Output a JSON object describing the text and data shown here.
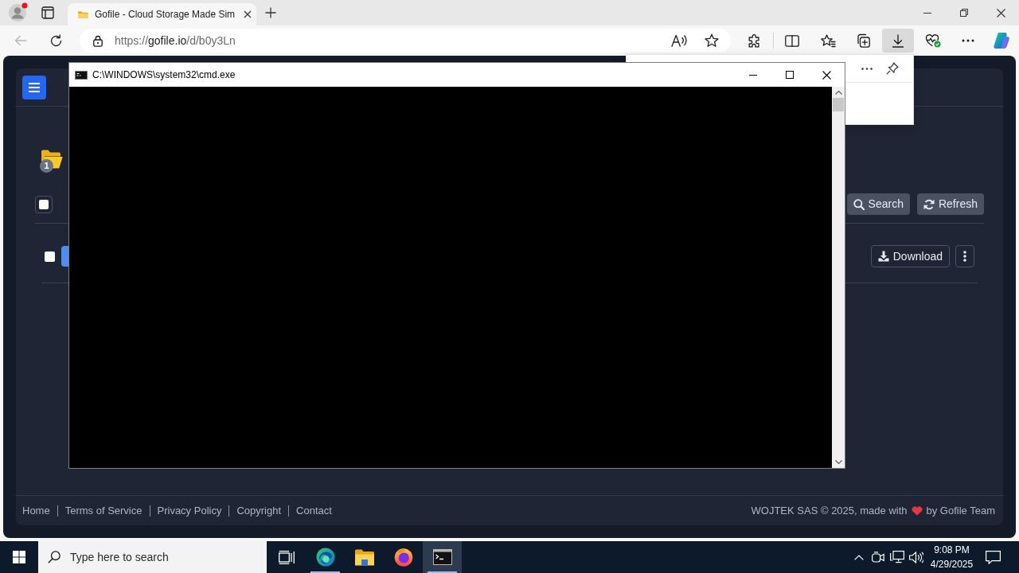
{
  "browser": {
    "tabs": [
      {
        "title": "Gofile - Cloud Storage Made Sim",
        "selected": true
      }
    ],
    "back_disabled": true,
    "address": {
      "scheme": "https://",
      "host": "gofile.io",
      "path": "/d/b0y3Ln"
    },
    "downloads_open": true
  },
  "page": {
    "folder": {
      "badge": "1"
    },
    "select_all": {
      "checked": false
    },
    "actions": [
      {
        "kind": "search",
        "label": "Search"
      },
      {
        "kind": "refresh",
        "label": "Refresh"
      }
    ],
    "files": [
      {
        "checked": false,
        "download": "Download"
      }
    ],
    "footer": {
      "links": [
        "Home",
        "Terms of Service",
        "Privacy Policy",
        "Copyright",
        "Contact"
      ],
      "credit_before": "WOJTEK SAS © 2025, made with",
      "credit_after": "by Gofile Team"
    }
  },
  "console_window": {
    "title": "C:\\WINDOWS\\system32\\cmd.exe"
  },
  "taskbar": {
    "search": {
      "placeholder": "Type here to search"
    },
    "apps": [
      {
        "kind": "edge",
        "running": true,
        "active": false
      },
      {
        "kind": "explorer",
        "running": false,
        "active": false
      },
      {
        "kind": "firefox",
        "running": false,
        "active": false
      },
      {
        "kind": "terminal",
        "running": true,
        "active": true
      }
    ],
    "clock": {
      "time": "9:08 PM",
      "date": "4/29/2025"
    }
  }
}
